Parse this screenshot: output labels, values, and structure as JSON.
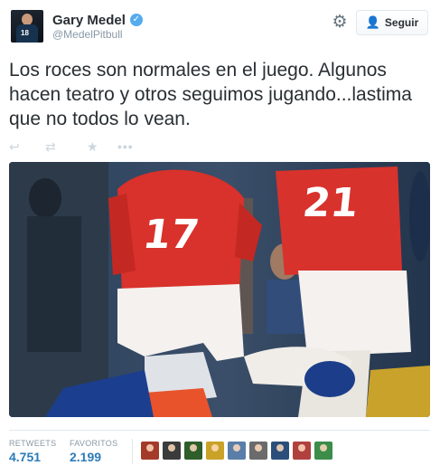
{
  "user": {
    "name": "Gary Medel",
    "handle": "@MedelPitbull",
    "avatar_jersey_number": "18"
  },
  "header": {
    "follow_label": "Seguir",
    "follow_icon": "add-user-icon",
    "settings_icon": "gear-icon",
    "verified_icon": "verified-badge-icon"
  },
  "tweet": {
    "text": "Los roces son normales en el juego. Algunos hacen teatro y otros seguimos jugando...lastima que no todos lo vean."
  },
  "actions": [
    {
      "name": "reply",
      "icon": "reply-icon",
      "glyph": "↩"
    },
    {
      "name": "retweet",
      "icon": "retweet-icon",
      "glyph": "⇄"
    },
    {
      "name": "favorite",
      "icon": "star-icon",
      "glyph": "★"
    },
    {
      "name": "more",
      "icon": "more-icon",
      "glyph": "•••"
    }
  ],
  "media": {
    "jersey_numbers": [
      "17",
      "21"
    ]
  },
  "stats": {
    "retweets_label": "RETWEETS",
    "retweets_count": "4.751",
    "favorites_label": "FAVORITOS",
    "favorites_count": "2.199"
  },
  "favoriters": [
    {
      "color": "#a33a2a"
    },
    {
      "color": "#3b3b3b"
    },
    {
      "color": "#2f5e2a"
    },
    {
      "color": "#c9a227"
    },
    {
      "color": "#5a7ea8"
    },
    {
      "color": "#6b6b6b"
    },
    {
      "color": "#2b4f7a"
    },
    {
      "color": "#b0413e"
    },
    {
      "color": "#3c8c4a"
    }
  ],
  "colors": {
    "accent": "#55acee",
    "count": "#2b7bb9",
    "muted": "#8899a6"
  }
}
